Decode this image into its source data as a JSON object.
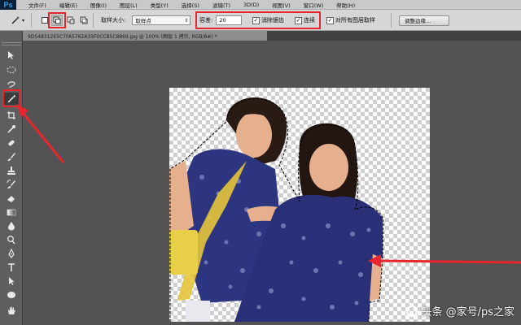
{
  "app": {
    "logo": "Ps"
  },
  "menu": [
    "文件(F)",
    "编辑(E)",
    "图像(I)",
    "图层(L)",
    "类型(Y)",
    "选择(S)",
    "滤镜(T)",
    "3D(D)",
    "视图(V)",
    "窗口(W)",
    "帮助(H)"
  ],
  "options": {
    "tool_icon": "magic-wand-icon",
    "sample_size_label": "取样大小:",
    "sample_size_value": "取样点",
    "tolerance_label": "容差:",
    "tolerance_value": "20",
    "antialias_label": "消除锯齿",
    "antialias_checked": true,
    "contiguous_label": "连续",
    "contiguous_checked": true,
    "sample_all_label": "对所有图层取样",
    "sample_all_checked": true,
    "refine_edge_label": "调整边缘..."
  },
  "document": {
    "tab_title": "9D548312E5C7FA5762A33F0CC85C8869.jpg @ 100% (图层 1 拷贝, RGB/8#) *"
  },
  "tools": [
    "move-tool-icon",
    "marquee-tool-icon",
    "lasso-tool-icon",
    "magic-wand-tool-icon",
    "crop-tool-icon",
    "eyedropper-tool-icon",
    "healing-brush-tool-icon",
    "brush-tool-icon",
    "clone-stamp-tool-icon",
    "history-brush-tool-icon",
    "eraser-tool-icon",
    "gradient-tool-icon",
    "blur-tool-icon",
    "dodge-tool-icon",
    "pen-tool-icon",
    "type-tool-icon",
    "path-selection-tool-icon",
    "shape-tool-icon",
    "hand-tool-icon"
  ],
  "selected_tool": "magic-wand-tool-icon",
  "watermark": "头条 @家号/ps之家",
  "colors": {
    "highlight": "#e8242c",
    "menubar": "#c9c9c9",
    "optionsbar": "#d6d6d6",
    "workspace": "#535353"
  }
}
